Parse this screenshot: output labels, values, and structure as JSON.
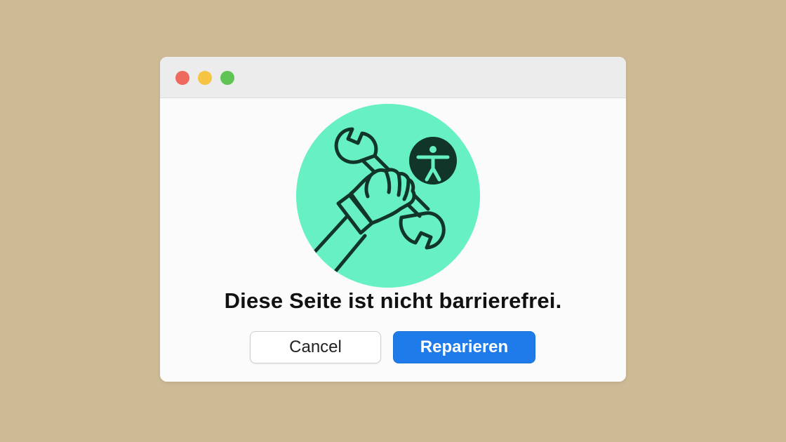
{
  "dialog": {
    "message": "Diese Seite ist nicht barrierefrei.",
    "cancel_label": "Cancel",
    "repair_label": "Reparieren"
  },
  "illustration": {
    "icons": [
      "hand-holding-wrench-icon",
      "accessibility-icon"
    ],
    "circle_color": "#66f0c3",
    "stroke_color": "#12352a"
  },
  "window_controls": [
    "close",
    "minimize",
    "zoom"
  ],
  "colors": {
    "background": "#cdbb95",
    "primary_button": "#1f7aea",
    "close": "#ee6a5e",
    "minimize": "#f5c443",
    "zoom": "#5fc454"
  }
}
